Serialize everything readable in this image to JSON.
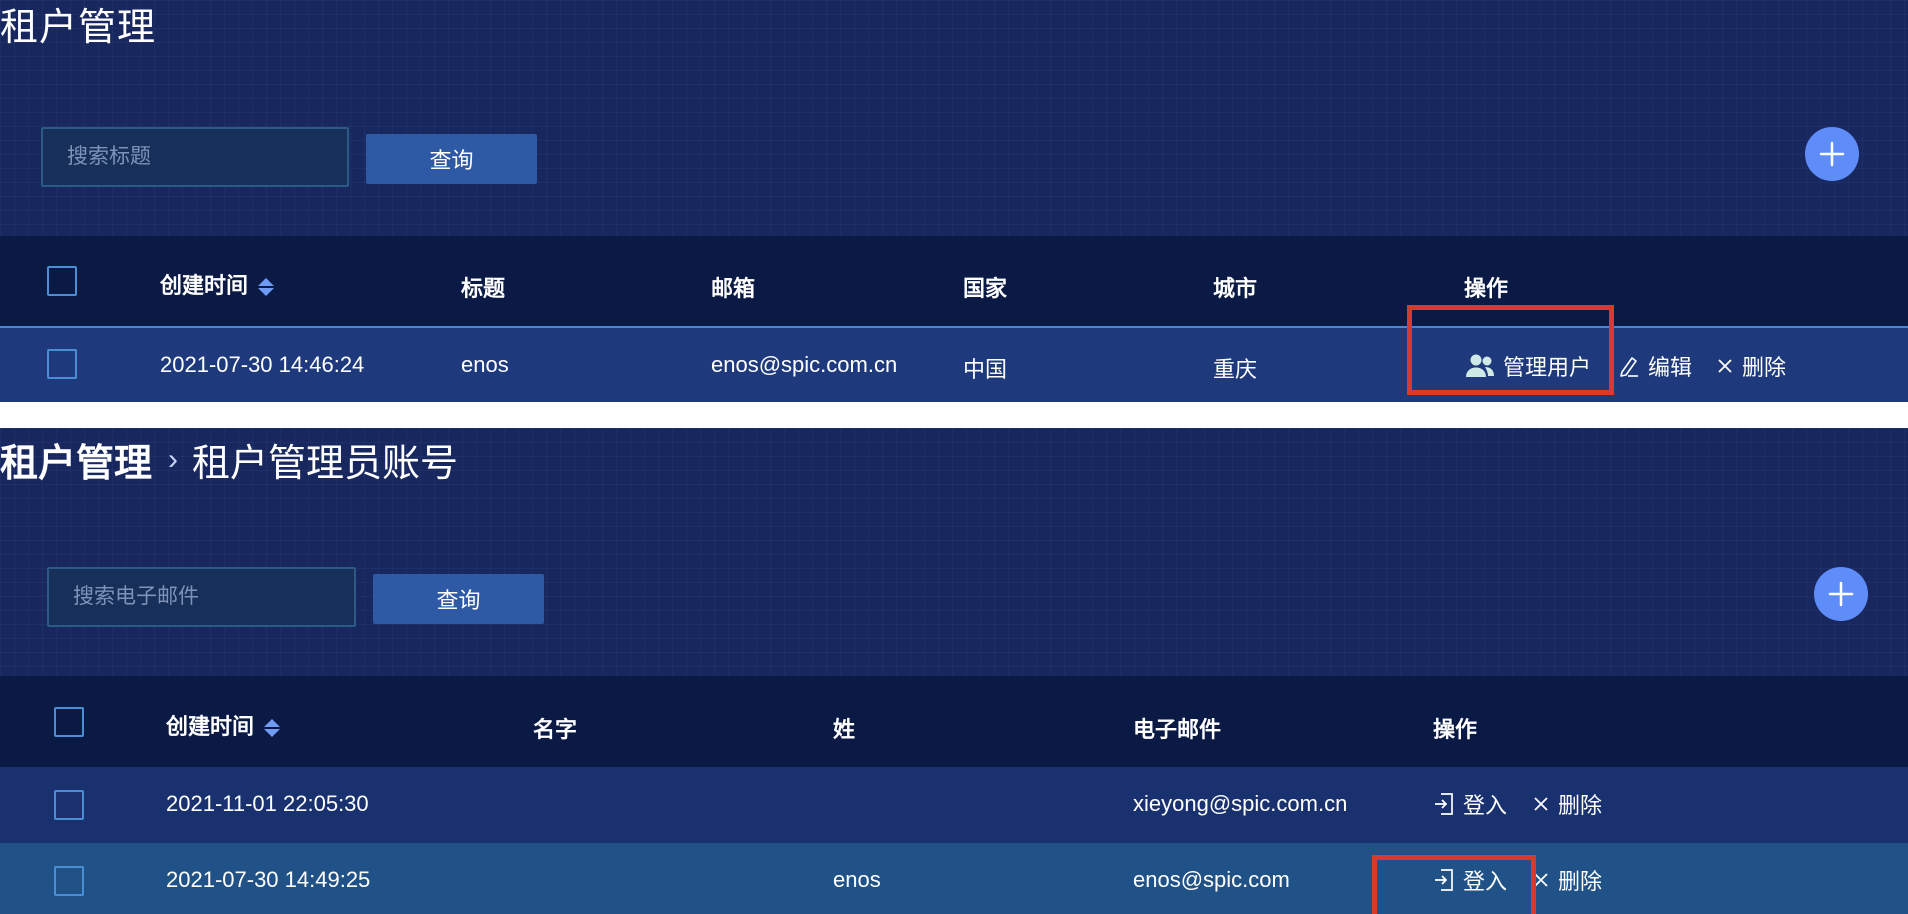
{
  "panel1": {
    "title": "租户管理",
    "search": {
      "placeholder": "搜索标题",
      "value": ""
    },
    "query_label": "查询",
    "add_icon": "plus-icon",
    "columns": [
      "创建时间",
      "标题",
      "邮箱",
      "国家",
      "城市",
      "操作"
    ],
    "rows": [
      {
        "created": "2021-07-30 14:46:24",
        "title": "enos",
        "email": "enos@spic.com.cn",
        "country": "中国",
        "city": "重庆",
        "actions": {
          "manage_users": "管理用户",
          "edit": "编辑",
          "delete": "删除"
        }
      }
    ]
  },
  "panel2": {
    "breadcrumb": {
      "parent": "租户管理",
      "separator": "›",
      "current": "租户管理员账号"
    },
    "search": {
      "placeholder": "搜索电子邮件",
      "value": ""
    },
    "query_label": "查询",
    "add_icon": "plus-icon",
    "columns": [
      "创建时间",
      "名字",
      "姓",
      "电子邮件",
      "操作"
    ],
    "rows": [
      {
        "created": "2021-11-01 22:05:30",
        "first_name": "",
        "last_name": "",
        "email": "xieyong@spic.com.cn",
        "login": "登入",
        "delete": "删除"
      },
      {
        "created": "2021-07-30 14:49:25",
        "first_name": "",
        "last_name": "enos",
        "email": "enos@spic.com",
        "login": "登入",
        "delete": "删除"
      }
    ]
  },
  "colors": {
    "background": "#18285e",
    "header": "#0b1a45",
    "button": "#2d59a5",
    "add_button": "#5e8dfa",
    "highlight_box": "#d83a2e",
    "checkbox_border": "#4a8fd6"
  }
}
